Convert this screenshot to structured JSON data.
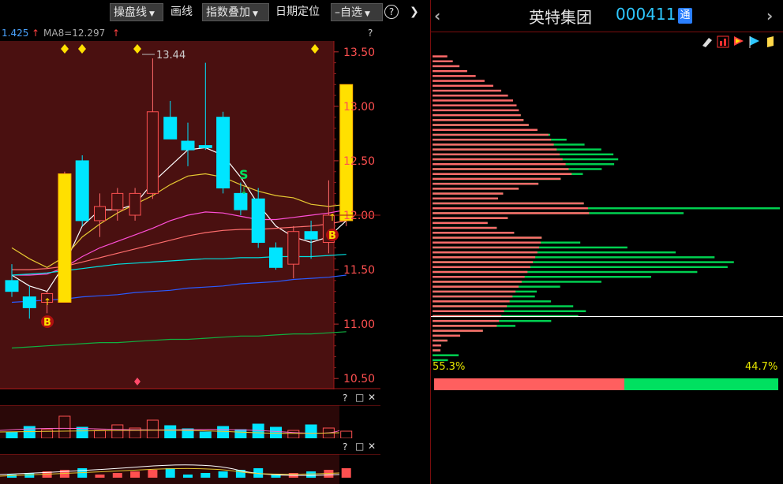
{
  "toolbar": {
    "drawing_label": "操盘线",
    "draw_line_label": "画线",
    "index_overlay_label": "指数叠加",
    "date_locate_label": "日期定位",
    "watchlist_label": "自选",
    "help_glyph": "?",
    "expand_glyph": "❯"
  },
  "ma_header": {
    "ma_prev_text": "1.425",
    "ma8_text": "MA8=12.297",
    "help": "?"
  },
  "price_axis": {
    "labels": [
      "13.50",
      "13.00",
      "12.50",
      "12.00",
      "11.50",
      "11.00",
      "10.50"
    ]
  },
  "annotations": {
    "high_label": "13.44",
    "buy_label": "B",
    "sell_label": "S"
  },
  "stock": {
    "name": "英特集团",
    "code": "000411",
    "badge": "通"
  },
  "chip_distribution": {
    "profit_pct": "55.3%",
    "loss_pct": "44.7%",
    "profit_color": "#ff5f5f",
    "loss_color": "#00e060"
  },
  "indicator_panes": {
    "pane1_help": "?",
    "pane2_help": "?"
  },
  "chart_data": {
    "type": "candlestick",
    "ylim": [
      10.4,
      13.6
    ],
    "candles": [
      {
        "o": 11.4,
        "h": 11.55,
        "l": 11.25,
        "c": 11.3
      },
      {
        "o": 11.25,
        "h": 11.35,
        "l": 11.05,
        "c": 11.15
      },
      {
        "o": 11.2,
        "h": 11.3,
        "l": 11.1,
        "c": 11.28
      },
      {
        "o": 11.2,
        "h": 12.4,
        "l": 11.2,
        "c": 12.38
      },
      {
        "o": 12.5,
        "h": 12.55,
        "l": 11.9,
        "c": 11.95
      },
      {
        "o": 11.95,
        "h": 12.2,
        "l": 11.8,
        "c": 12.08
      },
      {
        "o": 12.05,
        "h": 12.25,
        "l": 11.95,
        "c": 12.2
      },
      {
        "o": 12.0,
        "h": 12.25,
        "l": 11.95,
        "c": 12.2
      },
      {
        "o": 12.2,
        "h": 13.44,
        "l": 12.15,
        "c": 12.95
      },
      {
        "o": 12.9,
        "h": 13.05,
        "l": 12.7,
        "c": 12.7
      },
      {
        "o": 12.68,
        "h": 12.85,
        "l": 12.45,
        "c": 12.6
      },
      {
        "o": 12.64,
        "h": 13.4,
        "l": 12.6,
        "c": 12.62
      },
      {
        "o": 12.9,
        "h": 12.95,
        "l": 12.2,
        "c": 12.25
      },
      {
        "o": 12.2,
        "h": 12.3,
        "l": 12.0,
        "c": 12.05
      },
      {
        "o": 12.15,
        "h": 12.25,
        "l": 11.7,
        "c": 11.75
      },
      {
        "o": 11.7,
        "h": 11.75,
        "l": 11.5,
        "c": 11.52
      },
      {
        "o": 11.55,
        "h": 11.9,
        "l": 11.42,
        "c": 11.85
      },
      {
        "o": 11.85,
        "h": 11.95,
        "l": 11.6,
        "c": 11.78
      },
      {
        "o": 11.75,
        "h": 12.32,
        "l": 11.65,
        "c": 12.0
      },
      {
        "o": 11.95,
        "h": 13.2,
        "l": 11.9,
        "c": 13.2
      }
    ],
    "ma_lines": [
      {
        "color": "#ffffff",
        "values": [
          11.45,
          11.35,
          11.3,
          11.55,
          11.9,
          12.05,
          12.05,
          12.1,
          12.3,
          12.45,
          12.6,
          12.62,
          12.55,
          12.35,
          12.1,
          11.9,
          11.8,
          11.75,
          11.8,
          11.95
        ]
      },
      {
        "color": "#e6c832",
        "values": [
          11.7,
          11.6,
          11.52,
          11.62,
          11.8,
          11.92,
          12.02,
          12.1,
          12.18,
          12.28,
          12.36,
          12.38,
          12.35,
          12.28,
          12.22,
          12.18,
          12.16,
          12.1,
          12.08,
          12.1
        ]
      },
      {
        "color": "#ff4fd8",
        "values": [
          11.45,
          11.45,
          11.46,
          11.52,
          11.62,
          11.7,
          11.76,
          11.82,
          11.88,
          11.95,
          12.0,
          12.03,
          12.02,
          11.99,
          11.96,
          11.96,
          11.98,
          12.0,
          12.02,
          12.05
        ]
      },
      {
        "color": "#ff6e6e",
        "values": [
          11.5,
          11.5,
          11.51,
          11.53,
          11.57,
          11.61,
          11.65,
          11.69,
          11.73,
          11.77,
          11.81,
          11.84,
          11.86,
          11.87,
          11.87,
          11.88,
          11.89,
          11.9,
          11.92,
          11.95
        ]
      },
      {
        "color": "#00e0e0",
        "values": [
          11.45,
          11.46,
          11.47,
          11.49,
          11.51,
          11.53,
          11.55,
          11.56,
          11.57,
          11.58,
          11.59,
          11.6,
          11.6,
          11.61,
          11.61,
          11.62,
          11.62,
          11.62,
          11.63,
          11.64
        ]
      },
      {
        "color": "#2a5bff",
        "values": [
          11.2,
          11.21,
          11.22,
          11.23,
          11.25,
          11.26,
          11.27,
          11.29,
          11.3,
          11.31,
          11.33,
          11.34,
          11.35,
          11.37,
          11.38,
          11.39,
          11.41,
          11.42,
          11.43,
          11.45
        ]
      },
      {
        "color": "#10b040",
        "values": [
          10.78,
          10.79,
          10.8,
          10.81,
          10.82,
          10.83,
          10.83,
          10.84,
          10.85,
          10.86,
          10.86,
          10.87,
          10.88,
          10.89,
          10.89,
          10.9,
          10.91,
          10.91,
          10.92,
          10.93
        ]
      }
    ],
    "current_price": 12.0
  }
}
